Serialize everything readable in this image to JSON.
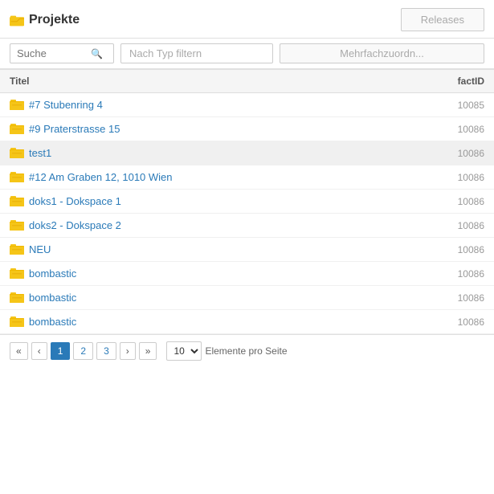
{
  "header": {
    "title": "Projekte",
    "releases_label": "Releases"
  },
  "toolbar": {
    "search_placeholder": "Suche",
    "filter_placeholder": "Nach Typ filtern",
    "multi_assign_label": "Mehrfachzuordn..."
  },
  "table": {
    "col_title": "Titel",
    "col_factid": "factID",
    "rows": [
      {
        "title": "#7 Stubenring 4",
        "factid": "10085"
      },
      {
        "title": "#9 Praterstrasse 15",
        "factid": "10086"
      },
      {
        "title": "test1",
        "factid": "10086",
        "selected": true
      },
      {
        "title": "#12 Am Graben 12, 1010 Wien",
        "factid": "10086"
      },
      {
        "title": "doks1 - Dokspace 1",
        "factid": "10086"
      },
      {
        "title": "doks2 - Dokspace 2",
        "factid": "10086"
      },
      {
        "title": "NEU",
        "factid": "10086"
      },
      {
        "title": "bombastic",
        "factid": "10086"
      },
      {
        "title": "bombastic",
        "factid": "10086"
      },
      {
        "title": "bombastic",
        "factid": "10086"
      }
    ]
  },
  "pagination": {
    "first_label": "«",
    "prev_label": "‹",
    "next_label": "›",
    "last_label": "»",
    "pages": [
      "1",
      "2",
      "3"
    ],
    "active_page": "1",
    "per_page_value": "10",
    "per_page_label": "Elemente pro Seite"
  }
}
